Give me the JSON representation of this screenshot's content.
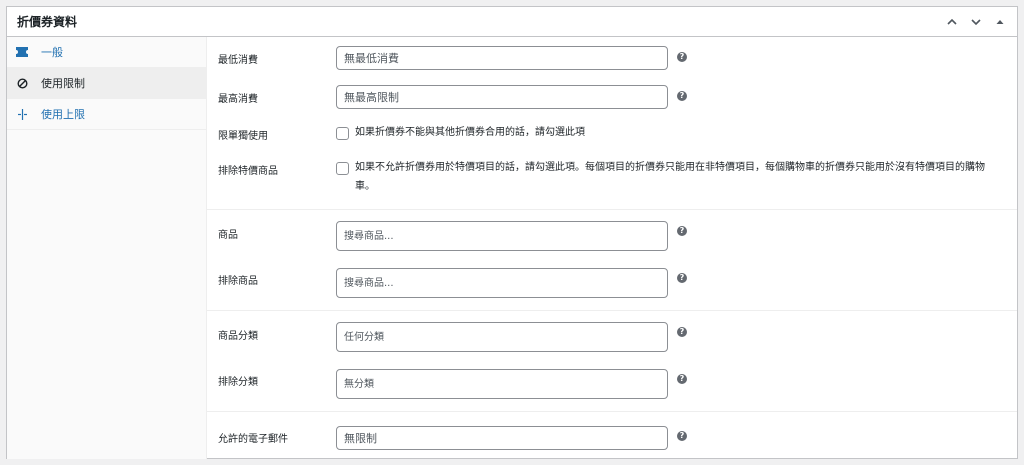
{
  "panel": {
    "title": "折價券資料"
  },
  "tabs": [
    {
      "label": "一般",
      "icon": "ticket-icon"
    },
    {
      "label": "使用限制",
      "icon": "ban-icon"
    },
    {
      "label": "使用上限",
      "icon": "plus-arrows-icon"
    }
  ],
  "fields": {
    "min_spend": {
      "label": "最低消費",
      "placeholder": "無最低消費"
    },
    "max_spend": {
      "label": "最高消費",
      "placeholder": "無最高限制"
    },
    "individual_use": {
      "label": "限單獨使用",
      "text": "如果折價券不能與其他折價券合用的話，請勾選此項"
    },
    "exclude_sale": {
      "label": "排除特價商品",
      "text_line1": "如果不允許折價券用於特價項目的話，請勾選此項。每個項目的折價券只能用在非特價項目，每個購物車的折價券只能用於沒有特價項目的購物",
      "text_line2": "車。"
    },
    "products": {
      "label": "商品",
      "placeholder": "搜尋商品..."
    },
    "exclude_products": {
      "label": "排除商品",
      "placeholder": "搜尋商品..."
    },
    "product_categories": {
      "label": "商品分類",
      "placeholder": "任何分類"
    },
    "exclude_categories": {
      "label": "排除分類",
      "placeholder": "無分類"
    },
    "allowed_emails": {
      "label": "允許的電子郵件",
      "placeholder": "無限制"
    }
  },
  "help_glyph": "?",
  "colors": {
    "link": "#2271b1",
    "border": "#c3c4c7",
    "help_bg": "#646970"
  }
}
